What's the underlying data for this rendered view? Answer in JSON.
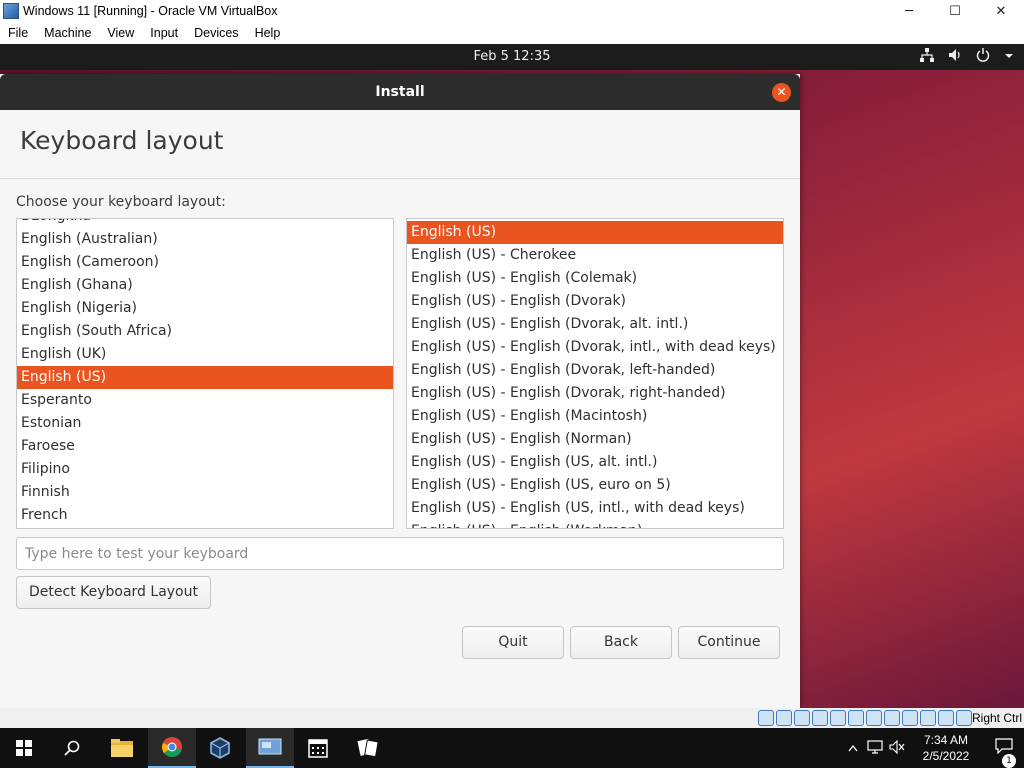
{
  "host_window": {
    "title": "Windows 11 [Running] - Oracle VM VirtualBox",
    "menu": [
      "File",
      "Machine",
      "View",
      "Input",
      "Devices",
      "Help"
    ],
    "controls": {
      "minimize": "─",
      "maximize": "☐",
      "close": "✕"
    }
  },
  "guest_topbar": {
    "clock": "Feb 5  12:35",
    "tray_icons": [
      "network-icon",
      "volume-icon",
      "power-icon",
      "chevron-down-icon"
    ]
  },
  "installer": {
    "window_title": "Install",
    "heading": "Keyboard layout",
    "choose_label": "Choose your keyboard layout:",
    "layouts": [
      "Dzongkha",
      "English (Australian)",
      "English (Cameroon)",
      "English (Ghana)",
      "English (Nigeria)",
      "English (South Africa)",
      "English (UK)",
      "English (US)",
      "Esperanto",
      "Estonian",
      "Faroese",
      "Filipino",
      "Finnish",
      "French"
    ],
    "selected_layout": "English (US)",
    "variants": [
      "English (US)",
      "English (US) - Cherokee",
      "English (US) - English (Colemak)",
      "English (US) - English (Dvorak)",
      "English (US) - English (Dvorak, alt. intl.)",
      "English (US) - English (Dvorak, intl., with dead keys)",
      "English (US) - English (Dvorak, left-handed)",
      "English (US) - English (Dvorak, right-handed)",
      "English (US) - English (Macintosh)",
      "English (US) - English (Norman)",
      "English (US) - English (US, alt. intl.)",
      "English (US) - English (US, euro on 5)",
      "English (US) - English (US, intl., with dead keys)",
      "English (US) - English (Workman)"
    ],
    "selected_variant": "English (US)",
    "test_placeholder": "Type here to test your keyboard",
    "test_value": "",
    "detect_button": "Detect Keyboard Layout",
    "quit_button": "Quit",
    "back_button": "Back",
    "continue_button": "Continue",
    "accent_color": "#e95420"
  },
  "vbox_status": {
    "host_key": "Right Ctrl",
    "icons": [
      "hard-disk-icon",
      "optical-drive-icon",
      "audio-icon",
      "network-icon",
      "usb-icon",
      "shared-folders-icon",
      "display-icon",
      "video-capture-icon",
      "recording-icon",
      "cpu-icon",
      "mouse-integration-icon",
      "keyboard-icon"
    ]
  },
  "taskbar": {
    "apps": [
      "start-icon",
      "search-icon",
      "file-explorer-icon",
      "chrome-icon",
      "virtualbox-app-icon",
      "virtualbox-vm-icon",
      "calendar-icon",
      "solitaire-icon"
    ],
    "time": "7:34 AM",
    "date": "2/5/2022",
    "notification_count": "1"
  }
}
